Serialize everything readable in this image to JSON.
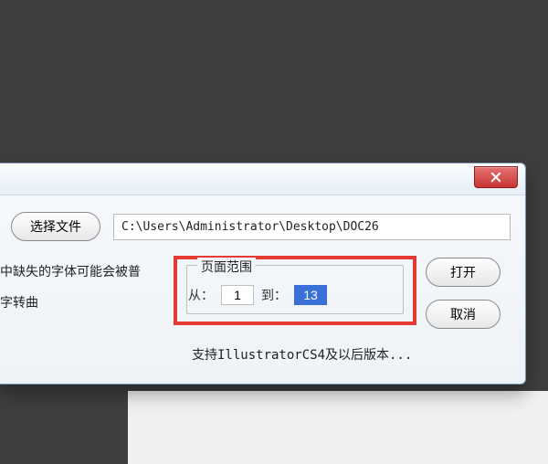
{
  "buttons": {
    "select_file": "选择文件",
    "open": "打开",
    "cancel": "取消"
  },
  "path": "C:\\Users\\Administrator\\Desktop\\DOC26",
  "truncated_lines": {
    "line1": "中缺失的字体可能会被普",
    "line2": "字转曲"
  },
  "range": {
    "legend": "页面范围",
    "from_label": "从：",
    "to_label": "到：",
    "from_value": "1",
    "to_value": "13"
  },
  "support_text": "支持IllustratorCS4及以后版本..."
}
